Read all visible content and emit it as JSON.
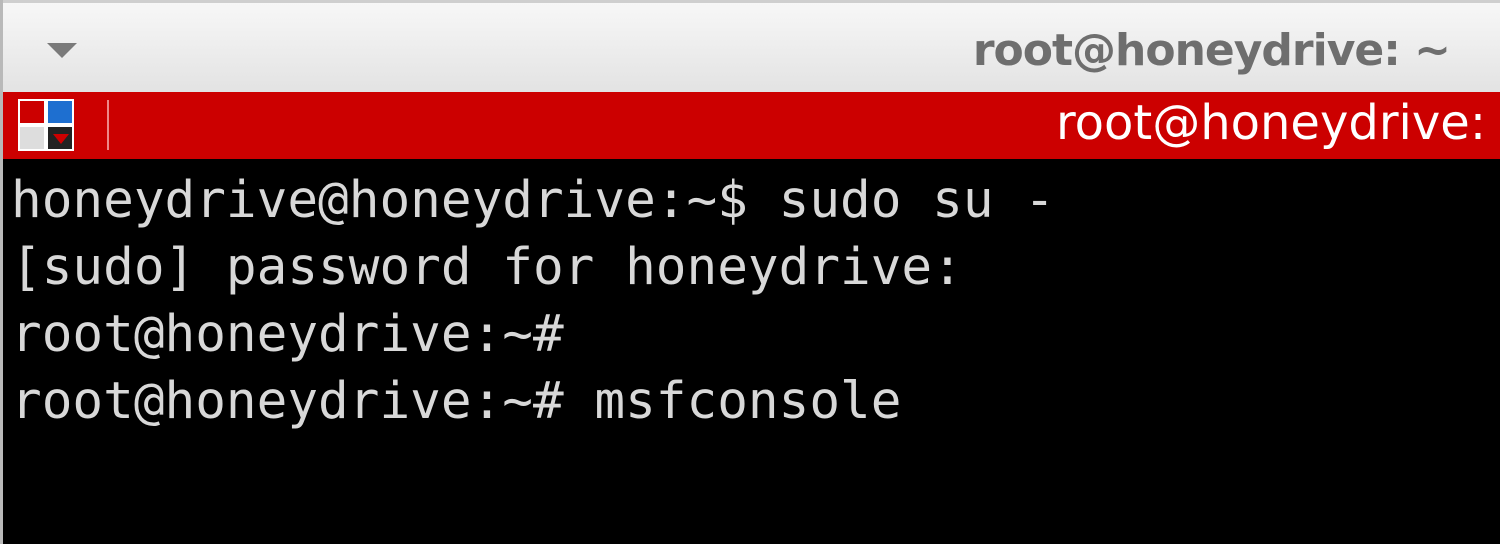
{
  "window": {
    "title": "root@honeydrive: ~"
  },
  "tab": {
    "title": "root@honeydrive:"
  },
  "terminal": {
    "lines": [
      "honeydrive@honeydrive:~$ sudo su -",
      "[sudo] password for honeydrive:",
      "root@honeydrive:~#",
      "root@honeydrive:~# msfconsole"
    ]
  },
  "colors": {
    "tabbar": "#cc0000",
    "terminal_bg": "#000000",
    "terminal_fg": "#d8d8d8"
  },
  "icons": {
    "menu": "dropdown-arrow-icon",
    "app": "terminal-app-icon"
  }
}
